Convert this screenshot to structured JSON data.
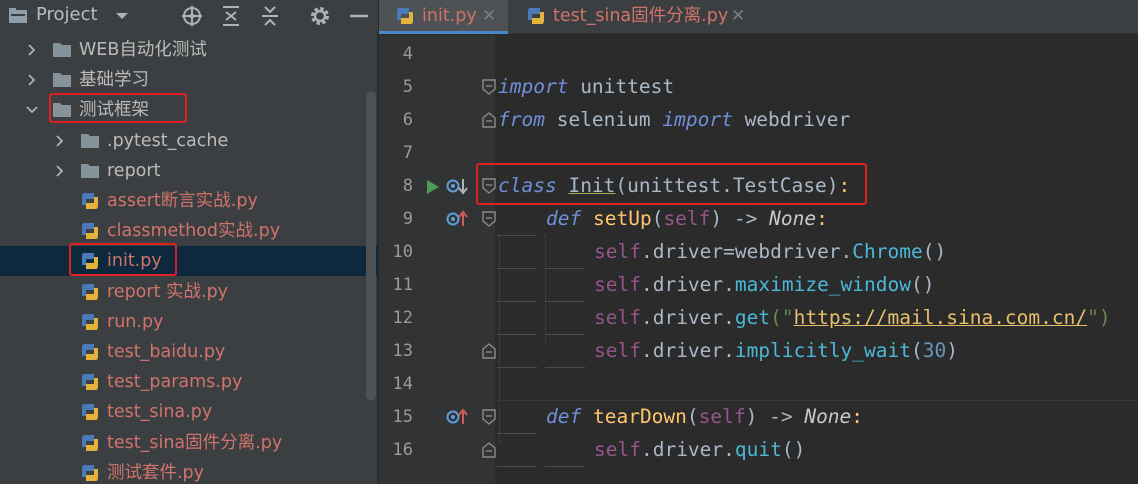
{
  "project": {
    "title": "Project",
    "header_icons": [
      "chevron-down-icon",
      "crosshair-icon",
      "expand-all-icon",
      "collapse-all-icon",
      "gear-icon",
      "minimize-icon"
    ],
    "tree": [
      {
        "label": "WEB自动化测试",
        "type": "dir",
        "expanded": false
      },
      {
        "label": "基础学习",
        "type": "dir",
        "expanded": false
      },
      {
        "label": "测试框架",
        "type": "dir",
        "expanded": true
      },
      {
        "label": ".pytest_cache",
        "type": "dir",
        "expanded": false
      },
      {
        "label": "report",
        "type": "dir",
        "expanded": false
      },
      {
        "label": "assert断言实战.py",
        "type": "file"
      },
      {
        "label": "classmethod实战.py",
        "type": "file"
      },
      {
        "label": "init.py",
        "type": "file"
      },
      {
        "label": "report 实战.py",
        "type": "file"
      },
      {
        "label": "run.py",
        "type": "file"
      },
      {
        "label": "test_baidu.py",
        "type": "file"
      },
      {
        "label": "test_params.py",
        "type": "file"
      },
      {
        "label": "test_sina.py",
        "type": "file"
      },
      {
        "label": "test_sina固件分离.py",
        "type": "file"
      },
      {
        "label": "测试套件.py",
        "type": "file"
      }
    ]
  },
  "editor": {
    "tabs": [
      {
        "label": "init.py",
        "close": "✕",
        "active": true
      },
      {
        "label": "test_sina固件分离.py",
        "close": "✕",
        "active": false
      }
    ],
    "line_numbers": [
      "4",
      "5",
      "6",
      "7",
      "8",
      "9",
      "10",
      "11",
      "12",
      "13",
      "14",
      "15",
      "16"
    ],
    "code": {
      "l5": {
        "kw": "import",
        "rest": " unittest"
      },
      "l6": {
        "kw1": "from",
        "mod": " selenium ",
        "kw2": "import",
        "rest": " webdriver"
      },
      "l8": {
        "kw": "class",
        "name": "Init",
        "rest": "(unittest.TestCase)",
        "colon": ":"
      },
      "l9": {
        "kw": "def",
        "name": "setUp",
        "p1": "(",
        "self": "self",
        "p2": ") -> ",
        "none": "None",
        "colon": ":"
      },
      "l10": {
        "self": "self",
        "a": ".driver=webdriver.",
        "meth": "Chrome",
        "b": "()"
      },
      "l11": {
        "self": "self",
        "a": ".driver.",
        "meth": "maximize_window",
        "b": "()"
      },
      "l12": {
        "self": "self",
        "a": ".driver.",
        "meth": "get",
        "b": "(\"",
        "url": "https://mail.sina.com.cn/",
        "c": "\")"
      },
      "l13": {
        "self": "self",
        "a": ".driver.",
        "meth": "implicitly_wait",
        "b": "(",
        "num": "30",
        "c": ")"
      },
      "l15": {
        "kw": "def",
        "name": "tearDown",
        "p1": "(",
        "self": "self",
        "p2": ") -> ",
        "none": "None",
        "colon": ":"
      },
      "l16": {
        "self": "self",
        "a": ".driver.",
        "meth": "quit",
        "b": "()"
      }
    }
  },
  "colors": {
    "accent": "#4a88c7",
    "highlight_box": "#e02020",
    "file_label": "#d0736c",
    "selected_row": "#0d293e"
  }
}
